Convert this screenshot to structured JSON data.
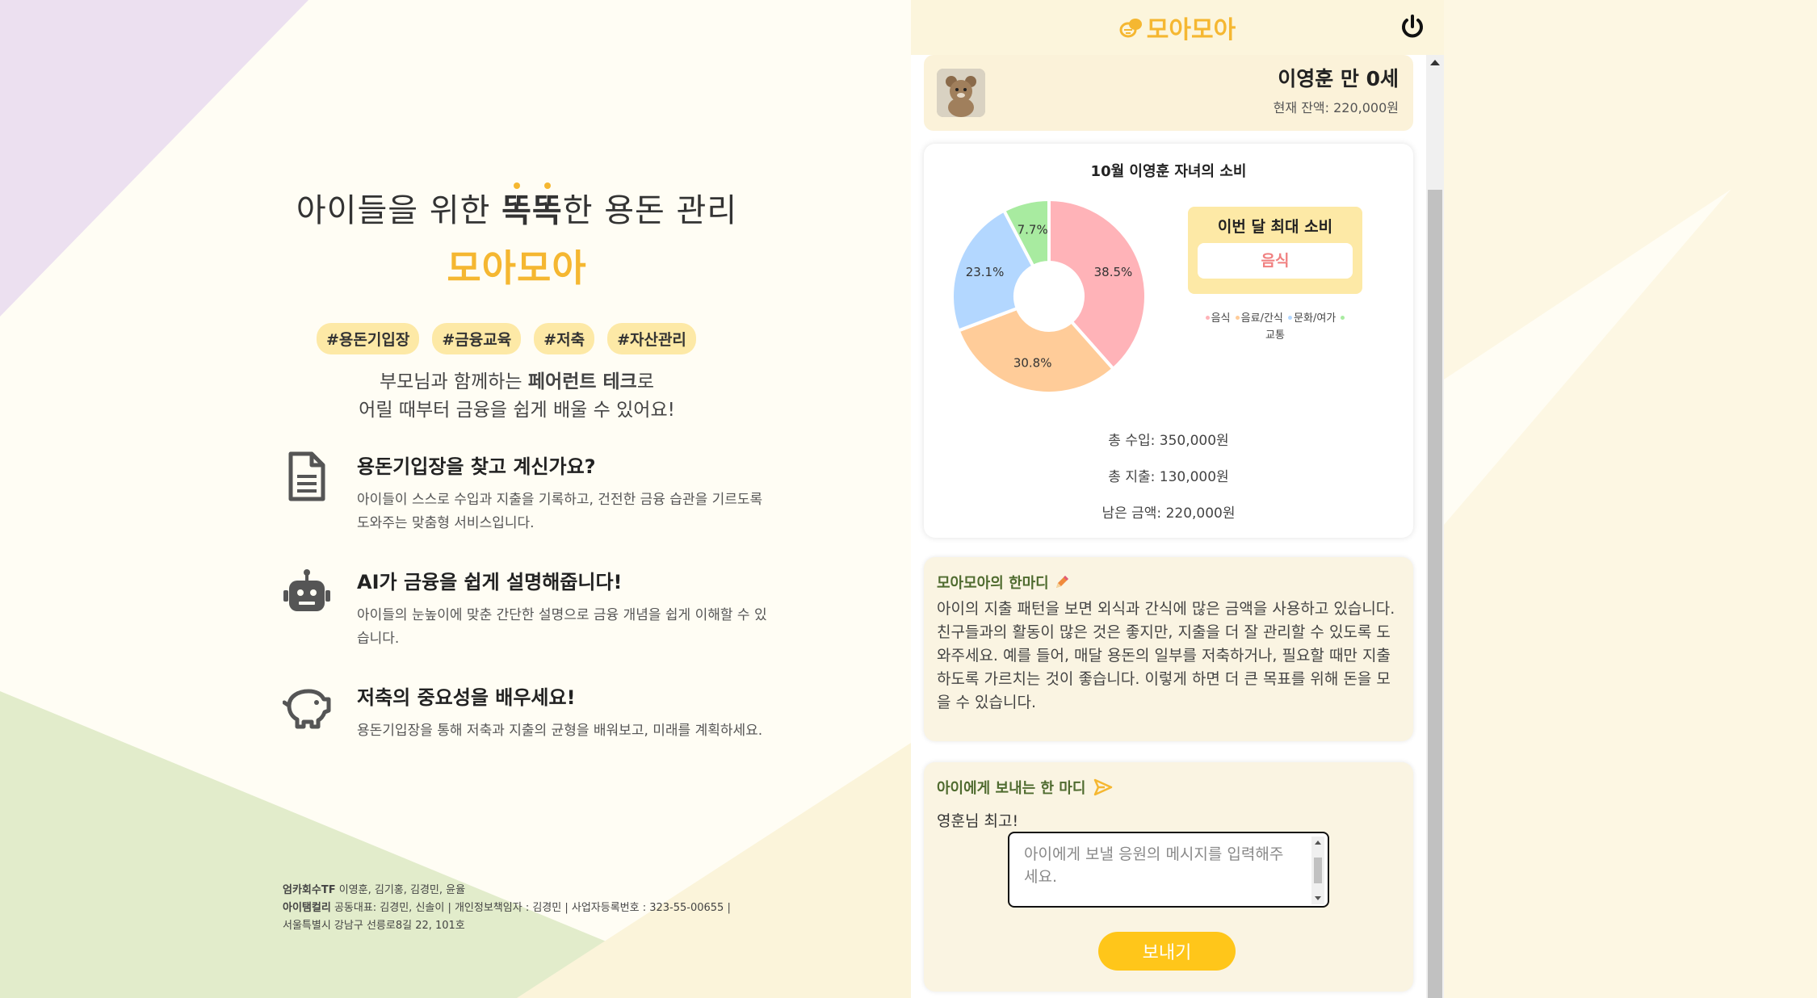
{
  "hero": {
    "line_prefix": "아이들을 위한 ",
    "line_bold": "똑똑",
    "line_suffix": "한 용돈 관리",
    "brand": "모아모아"
  },
  "tags": [
    "#용돈기입장",
    "#금융교육",
    "#저축",
    "#자산관리"
  ],
  "subtitle": {
    "line1_prefix": "부모님과 함께하는 ",
    "line1_bold": "페어런트 테크",
    "line1_suffix": "로",
    "line2": "어릴 때부터 금융을 쉽게 배울 수 있어요!"
  },
  "features": [
    {
      "icon": "document-icon",
      "title": "용돈기입장을 찾고 계신가요?",
      "desc": "아이들이 스스로 수입과 지출을 기록하고, 건전한 금융 습관을 기르도록 도와주는 맞춤형 서비스입니다."
    },
    {
      "icon": "robot-icon",
      "title": "AI가 금융을 쉽게 설명해줍니다!",
      "desc": "아이들의 눈높이에 맞춘 간단한 설명으로 금융 개념을 쉽게 이해할 수 있습니다."
    },
    {
      "icon": "piggy-bank-icon",
      "title": "저축의 중요성을 배우세요!",
      "desc": "용돈기입장을 통해 저축과 지출의 균형을 배워보고, 미래를 계획하세요."
    }
  ],
  "footer": {
    "team_label": "엄카회수TF",
    "team_members": " 이영훈, 김기홍, 김경민, 윤율",
    "company_label": "아이탬컬리",
    "company_info": " 공동대표: 김경민, 신솔이 | 개인정보책임자 : 김경민 | 사업자등록번호 : 323-55-00655 |",
    "address": "서울특별시 강남구 선릉로8길 22, 101호"
  },
  "app": {
    "logo_text": "모아모아",
    "profile_name": "이영훈 만 0세",
    "profile_balance": "현재 잔액: 220,000원",
    "max_label": "이번 달 최대 소비",
    "max_value": "음식",
    "total_income": "총 수입: 350,000원",
    "total_expense": "총 지출: 130,000원",
    "remaining": "남은 금액: 220,000원",
    "advice_title": "모아모아의 한마디",
    "advice_text": "아이의 지출 패턴을 보면 외식과 간식에 많은 금액을 사용하고 있습니다. 친구들과의 활동이 많은 것은 좋지만, 지출을 더 잘 관리할 수 있도록 도와주세요. 예를 들어, 매달 용돈의 일부를 저축하거나, 필요할 때만 지출하도록 가르치는 것이 좋습니다. 이렇게 하면 더 큰 목표를 위해 돈을 모을 수 있습니다.",
    "send_title": "아이에게 보내는 한 마디",
    "last_message": "영훈님 최고!",
    "message_placeholder": "아이에게 보낼 응원의 메시지를 입력해주세요.",
    "send_button": "보내기"
  },
  "colors": {
    "accent": "#f5b731",
    "button": "#ffc61a",
    "food": "#ffb3b8",
    "drink": "#ffcc99",
    "culture": "#b3d7ff",
    "transport": "#a8eba0"
  },
  "chart_data": {
    "type": "pie",
    "title": "10월 이영훈 자녀의 소비",
    "categories": [
      "음식",
      "음료/간식",
      "문화/여가",
      "교통"
    ],
    "values": [
      38.5,
      30.8,
      23.1,
      7.7
    ],
    "value_labels": [
      "38.5%",
      "30.8%",
      "23.1%",
      "7.7%"
    ],
    "donut": true,
    "legend_position": "right"
  }
}
